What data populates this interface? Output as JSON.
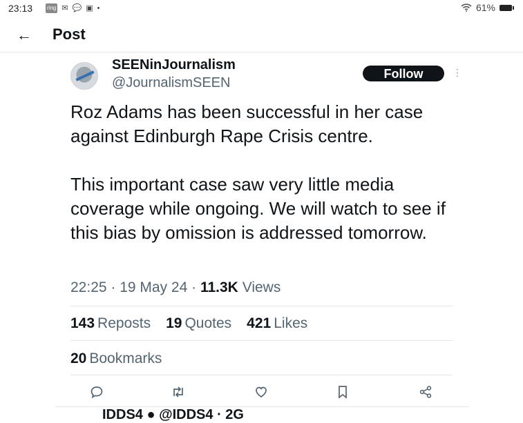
{
  "status_bar": {
    "time": "23:13",
    "left_icons": [
      "ring-app-icon",
      "mail-icon",
      "chat-icon",
      "media-icon",
      "dot-icon"
    ],
    "ring_label": "ring",
    "battery": "61%",
    "wifi_icon": "wifi-icon",
    "battery_icon": "battery-icon"
  },
  "header": {
    "title": "Post",
    "back_icon": "arrow-left-icon"
  },
  "post": {
    "author_name": "SEENinJournalism",
    "author_handle": "@JournalismSEEN",
    "follow_label": "Follow",
    "text": "Roz Adams has been successful in her case against Edinburgh Rape Crisis centre.\n\nThis important case saw very little media coverage while ongoing. We will watch to see if this bias by omission is addressed tomorrow.",
    "time": "22:25",
    "date": "19 May 24",
    "views_count": "11.3K",
    "views_label": "Views",
    "reposts_count": "143",
    "reposts_label": "Reposts",
    "quotes_count": "19",
    "quotes_label": "Quotes",
    "likes_count": "421",
    "likes_label": "Likes",
    "bookmarks_count": "20",
    "bookmarks_label": "Bookmarks"
  },
  "actions": [
    "reply-icon",
    "repost-icon",
    "like-icon",
    "bookmark-icon",
    "share-icon"
  ],
  "next_reply_preview": "IDDS4 ● @IDDS4 · 2G"
}
